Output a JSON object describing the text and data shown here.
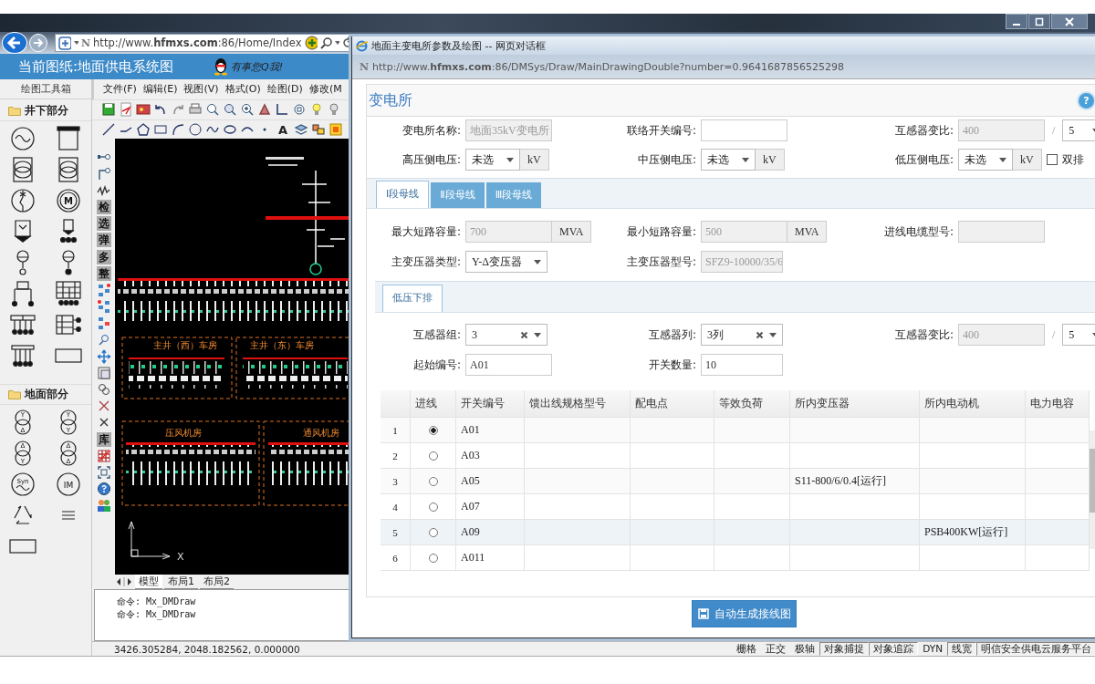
{
  "browser": {
    "favicon": "N",
    "url": "http://www.**hfmxs.com**:86/Home/Index"
  },
  "app": {
    "title": "当前图纸:地面供电系统图",
    "qq_text": "有事您Q我!"
  },
  "toolbox": {
    "title": "绘图工具箱",
    "sections": [
      {
        "label": "井下部分",
        "items": [
          {
            "kind": "sine-source"
          },
          {
            "kind": "breaker-box"
          },
          {
            "kind": "transformer-frame"
          },
          {
            "kind": "transformer-frame"
          },
          {
            "kind": "isolator"
          },
          {
            "kind": "motor",
            "label": "M"
          },
          {
            "kind": "feeder"
          },
          {
            "kind": "feeder-dots"
          },
          {
            "kind": "lamp"
          },
          {
            "kind": "lamp-dot"
          },
          {
            "kind": "cabinet"
          },
          {
            "kind": "panel"
          },
          {
            "kind": "busbar-double"
          },
          {
            "kind": "busbar-side"
          },
          {
            "kind": "busbar-comb"
          },
          {
            "kind": "blank-frame"
          }
        ]
      },
      {
        "label": "地面部分",
        "items": [
          {
            "kind": "transformer",
            "top": "Y",
            "bottom": "Δ"
          },
          {
            "kind": "transformer",
            "top": "Y",
            "bottom": "Y"
          },
          {
            "kind": "transformer",
            "top": "Δ",
            "bottom": "Y"
          },
          {
            "kind": "transformer",
            "top": "Δ",
            "bottom": "Δ"
          },
          {
            "kind": "generator",
            "label": "Syn"
          },
          {
            "kind": "machine",
            "label": "IM"
          },
          {
            "kind": "recycle"
          },
          {
            "kind": "triple-line"
          },
          {
            "kind": "blank-frame"
          }
        ]
      }
    ]
  },
  "menu": [
    "文件(F)",
    "编辑(E)",
    "视图(V)",
    "格式(O)",
    "绘图(D)",
    "修改(M"
  ],
  "text_tool": "A",
  "vtools": [
    {
      "kind": "icon"
    },
    {
      "kind": "icon"
    },
    {
      "kind": "icon"
    },
    {
      "kind": "glyph",
      "text": "检"
    },
    {
      "kind": "glyph",
      "text": "选"
    },
    {
      "kind": "glyph",
      "text": "弹"
    },
    {
      "kind": "glyph",
      "text": "多"
    },
    {
      "kind": "glyph",
      "text": "整"
    },
    {
      "kind": "icon"
    },
    {
      "kind": "icon"
    },
    {
      "kind": "icon"
    },
    {
      "kind": "icon"
    },
    {
      "kind": "icon"
    },
    {
      "kind": "icon"
    },
    {
      "kind": "icon"
    },
    {
      "kind": "icon"
    },
    {
      "kind": "icon"
    },
    {
      "kind": "glyph",
      "text": "库"
    },
    {
      "kind": "icon"
    },
    {
      "kind": "icon"
    },
    {
      "kind": "icon"
    },
    {
      "kind": "icon"
    }
  ],
  "canvas": {
    "labels": [
      "主井（西）车房",
      "主井（东）车房",
      "压风机房",
      "通风机房"
    ],
    "axis_label": "X"
  },
  "layout_tabs": [
    {
      "label": "模型",
      "selected": true
    },
    {
      "label": "布局1",
      "selected": false
    },
    {
      "label": "布局2",
      "selected": false
    }
  ],
  "command_lines": [
    "命令: Mx_DMDraw",
    "命令: Mx_DMDraw"
  ],
  "status": {
    "coords": "3426.305284,  2048.182562,  0.000000",
    "toggles": [
      {
        "label": "栅格",
        "on": false
      },
      {
        "label": "正交",
        "on": false
      },
      {
        "label": "极轴",
        "on": false
      },
      {
        "label": "对象捕捉",
        "on": true
      },
      {
        "label": "对象追踪",
        "on": true
      },
      {
        "label": "DYN",
        "on": false
      },
      {
        "label": "线宽",
        "on": true
      }
    ],
    "platform": "明信安全供电云服务平台"
  },
  "dialog": {
    "title": "地面主变电所参数及绘图 -- 网页对话框",
    "favicon": "N",
    "url": "http://www.**hfmxs.com**:86/DMSys/Draw/MainDrawingDouble?number=0.9641687856525298",
    "heading": "变电所",
    "help": "?",
    "sections": [
      {
        "kind": "form",
        "rows": [
          [
            {
              "label": "变电所名称:",
              "kind": "input",
              "value": "地面35kV变电所",
              "disabled": true
            },
            {
              "label": "联络开关编号:",
              "kind": "input",
              "disabled": false
            },
            {
              "label": "互感器变比:",
              "kind": "ratio",
              "value": "400",
              "separator": "/",
              "option": "5",
              "disabled": true
            }
          ],
          [
            {
              "label": "高压侧电压:",
              "kind": "select_unit",
              "value": "未选",
              "unit": "kV",
              "disabled": false
            },
            {
              "label": "中压侧电压:",
              "kind": "select_unit",
              "value": "未选",
              "unit": "kV",
              "disabled": false
            },
            {
              "label": "低压侧电压:",
              "kind": "select_unit",
              "value": "未选",
              "unit": "kV",
              "disabled": false,
              "checkbox": {
                "label": "双排",
                "checked": false
              }
            }
          ]
        ]
      },
      {
        "kind": "tabs",
        "tabs": [
          {
            "label": "Ⅰ段母线",
            "selected": true
          },
          {
            "label": "Ⅱ段母线",
            "selected": false
          },
          {
            "label": "Ⅲ段母线",
            "selected": false
          }
        ]
      },
      {
        "kind": "form",
        "rows": [
          [
            {
              "label": "最大短路容量:",
              "kind": "unit",
              "value": "700",
              "unit": "MVA",
              "disabled": true
            },
            {
              "label": "最小短路容量:",
              "kind": "unit",
              "value": "500",
              "unit": "MVA",
              "disabled": true
            },
            {
              "label": "进线电缆型号:",
              "kind": "input",
              "disabled": true
            }
          ],
          [
            {
              "label": "主变压器类型:",
              "kind": "select",
              "value": "Y-Δ变压器",
              "disabled": false
            },
            {
              "label": "主变压器型号:",
              "kind": "input",
              "value": "SFZ9-10000/35/6",
              "disabled": true
            }
          ]
        ]
      },
      {
        "kind": "tabs",
        "tabs": [
          {
            "label": "低压下排",
            "selected": true
          }
        ]
      },
      {
        "kind": "form",
        "rows": [
          [
            {
              "label": "互感器组:",
              "kind": "combo",
              "value": "3",
              "disabled": false
            },
            {
              "label": "互感器列:",
              "kind": "combo",
              "value": "3列",
              "disabled": false
            },
            {
              "label": "互感器变比:",
              "kind": "ratio",
              "value": "400",
              "separator": "/",
              "option": "5",
              "disabled": true
            }
          ],
          [
            {
              "label": "起始编号:",
              "kind": "input",
              "value": "A01",
              "disabled": false
            },
            {
              "label": "开关数量:",
              "kind": "input",
              "value": "10",
              "disabled": false
            }
          ]
        ]
      },
      {
        "kind": "table",
        "columns": [
          "进线",
          "开关编号",
          "馈出线规格型号",
          "配电点",
          "等效负荷",
          "所内变压器",
          "所内电动机",
          "电力电容"
        ],
        "rows": [
          {
            "index": "1",
            "selected": true,
            "highlighted": false,
            "cells": [
              null,
              "A01",
              null,
              null,
              null,
              null,
              null,
              null
            ]
          },
          {
            "index": "2",
            "selected": false,
            "highlighted": false,
            "cells": [
              null,
              "A03",
              null,
              null,
              null,
              null,
              null,
              null
            ]
          },
          {
            "index": "3",
            "selected": false,
            "highlighted": false,
            "cells": [
              null,
              "A05",
              null,
              null,
              null,
              "S11-800/6/0.4[运行]",
              null,
              null
            ]
          },
          {
            "index": "4",
            "selected": false,
            "highlighted": false,
            "cells": [
              null,
              "A07",
              null,
              null,
              null,
              null,
              null,
              null
            ]
          },
          {
            "index": "5",
            "selected": false,
            "highlighted": true,
            "cells": [
              null,
              "A09",
              null,
              null,
              null,
              null,
              "PSB400KW[运行]",
              null
            ]
          },
          {
            "index": "6",
            "selected": false,
            "highlighted": false,
            "cells": [
              null,
              "A011",
              null,
              null,
              null,
              null,
              null,
              null
            ]
          }
        ]
      }
    ],
    "button": "自动生成接线图"
  }
}
